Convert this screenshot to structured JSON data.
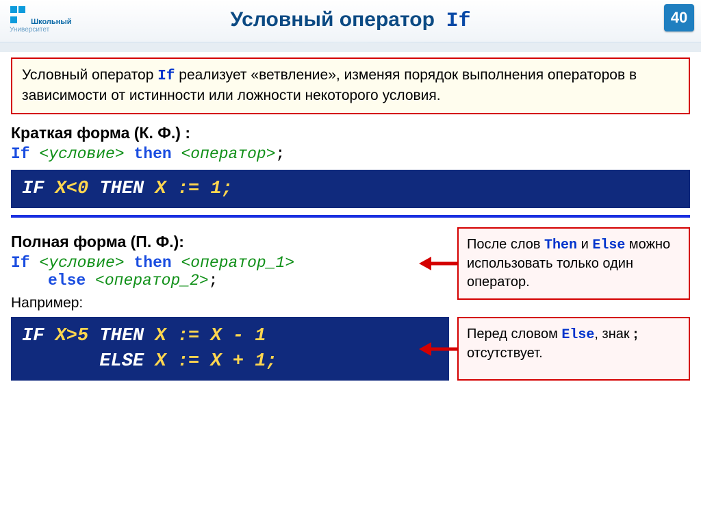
{
  "header": {
    "logo_line1": "Школьный",
    "logo_line2": "Университет",
    "title_text": "Условный оператор",
    "title_code": "If",
    "page_number": "40"
  },
  "intro": {
    "p1_a": "Условный оператор ",
    "p1_code": "If",
    "p1_b": " реализует «ветвление», изменяя порядок выполнения операторов в зависимости от истинности или ложности некоторого условия."
  },
  "short_form": {
    "heading": "Краткая форма (К. Ф.) :",
    "if": "If",
    "cond": "<условие>",
    "then": "then",
    "op": "<оператор>",
    "semi": ";",
    "code_w1": "IF ",
    "code_y1": "X<0",
    "code_w2": " THEN ",
    "code_y2": "X := 1;"
  },
  "full_form": {
    "heading": "Полная форма (П. Ф.):",
    "if": "If",
    "cond": "<условие>",
    "then": "then",
    "op1": "<оператор_1>",
    "else": "else",
    "op2": "<оператор_2>",
    "semi": ";"
  },
  "note1": {
    "a": "После слов ",
    "c1": "Then",
    "b": " и ",
    "c2": "Else",
    "d": " можно использовать только один оператор."
  },
  "example_label": "Например:",
  "code2": {
    "w1": "IF ",
    "y1": "X>5",
    "w2": " THEN ",
    "y2": "X := X - 1",
    "nl_pad": "       ",
    "w3": "ELSE ",
    "y3": "X := X + 1;"
  },
  "note2": {
    "a": "Перед словом ",
    "c1": "Else",
    "b": ", знак ",
    "semi": ";",
    "d": " отсутствует."
  }
}
